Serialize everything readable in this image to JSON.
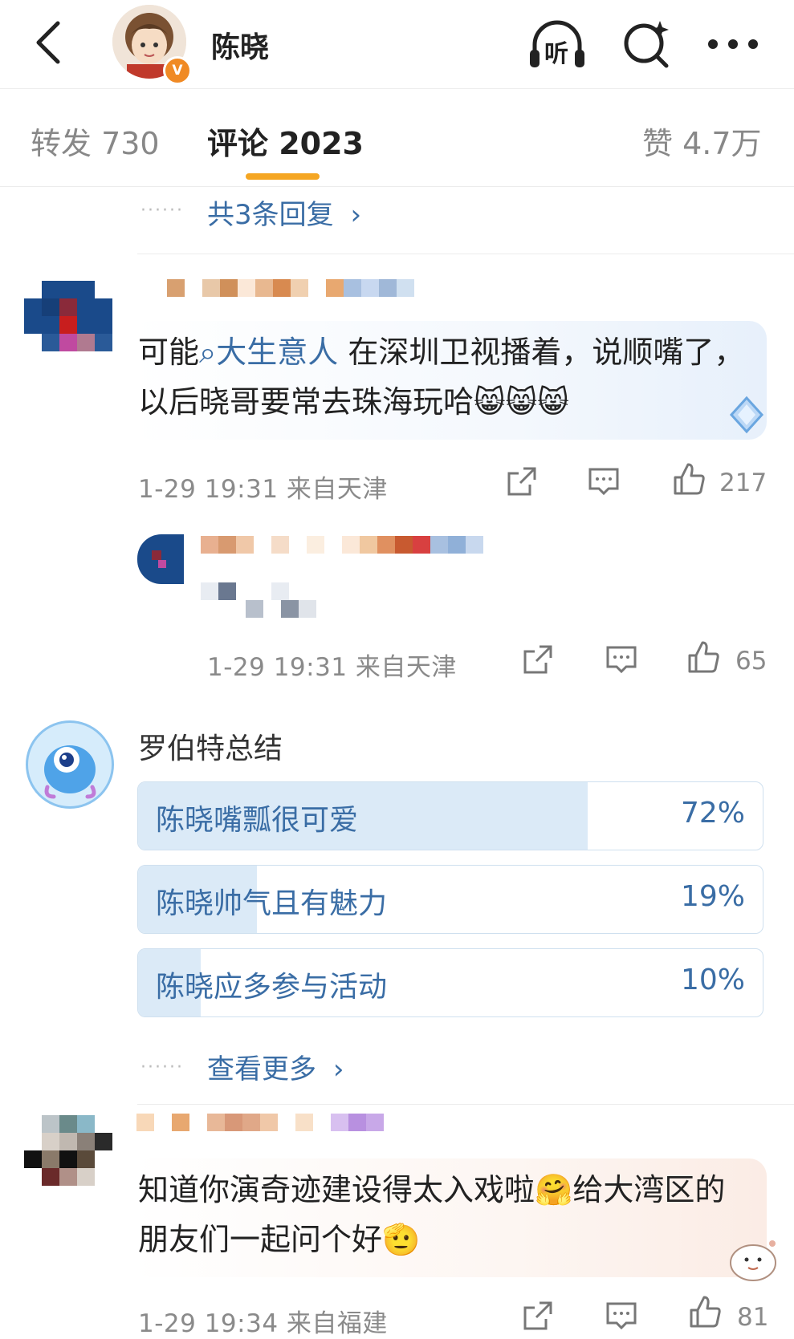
{
  "header": {
    "username": "陈晓",
    "verified_badge": "V",
    "listen_label": "听",
    "icons": [
      "back-arrow-icon",
      "listen-headphones-icon",
      "search-sparkle-icon",
      "more-icon"
    ]
  },
  "tabs": [
    {
      "label": "转发 730",
      "active": false
    },
    {
      "label": "评论 2023",
      "active": true
    },
    {
      "label": "赞 4.7万",
      "active": false
    }
  ],
  "reply_thread_link": "共3条回复",
  "comments": [
    {
      "text_before": "可能",
      "mention": "大生意人",
      "text_after": " 在深圳卫视播着，说顺嘴了，以后晓哥要常去珠海玩哈😸😸😸",
      "meta": "1-29 19:31 来自天津",
      "likes": "217"
    },
    {
      "meta": "1-29 19:31 来自天津",
      "likes": "65"
    },
    {
      "text": "知道你演奇迹建设得太入戏啦🤗给大湾区的朋友们一起问个好🫡",
      "meta": "1-29 19:34 来自福建",
      "likes": "81"
    }
  ],
  "poll": {
    "author": "罗伯特总结",
    "options": [
      {
        "label": "陈晓嘴瓢很可爱",
        "percent_text": "72%",
        "percent": 72
      },
      {
        "label": "陈晓帅气且有魅力",
        "percent_text": "19%",
        "percent": 19
      },
      {
        "label": "陈晓应多参与活动",
        "percent_text": "10%",
        "percent": 10
      }
    ],
    "more_link": "查看更多"
  },
  "colors": {
    "accent_underline": "#f5a623",
    "link_blue": "#3a6da5",
    "poll_fill": "#dbeaf7",
    "verified_orange": "#f08a24"
  }
}
